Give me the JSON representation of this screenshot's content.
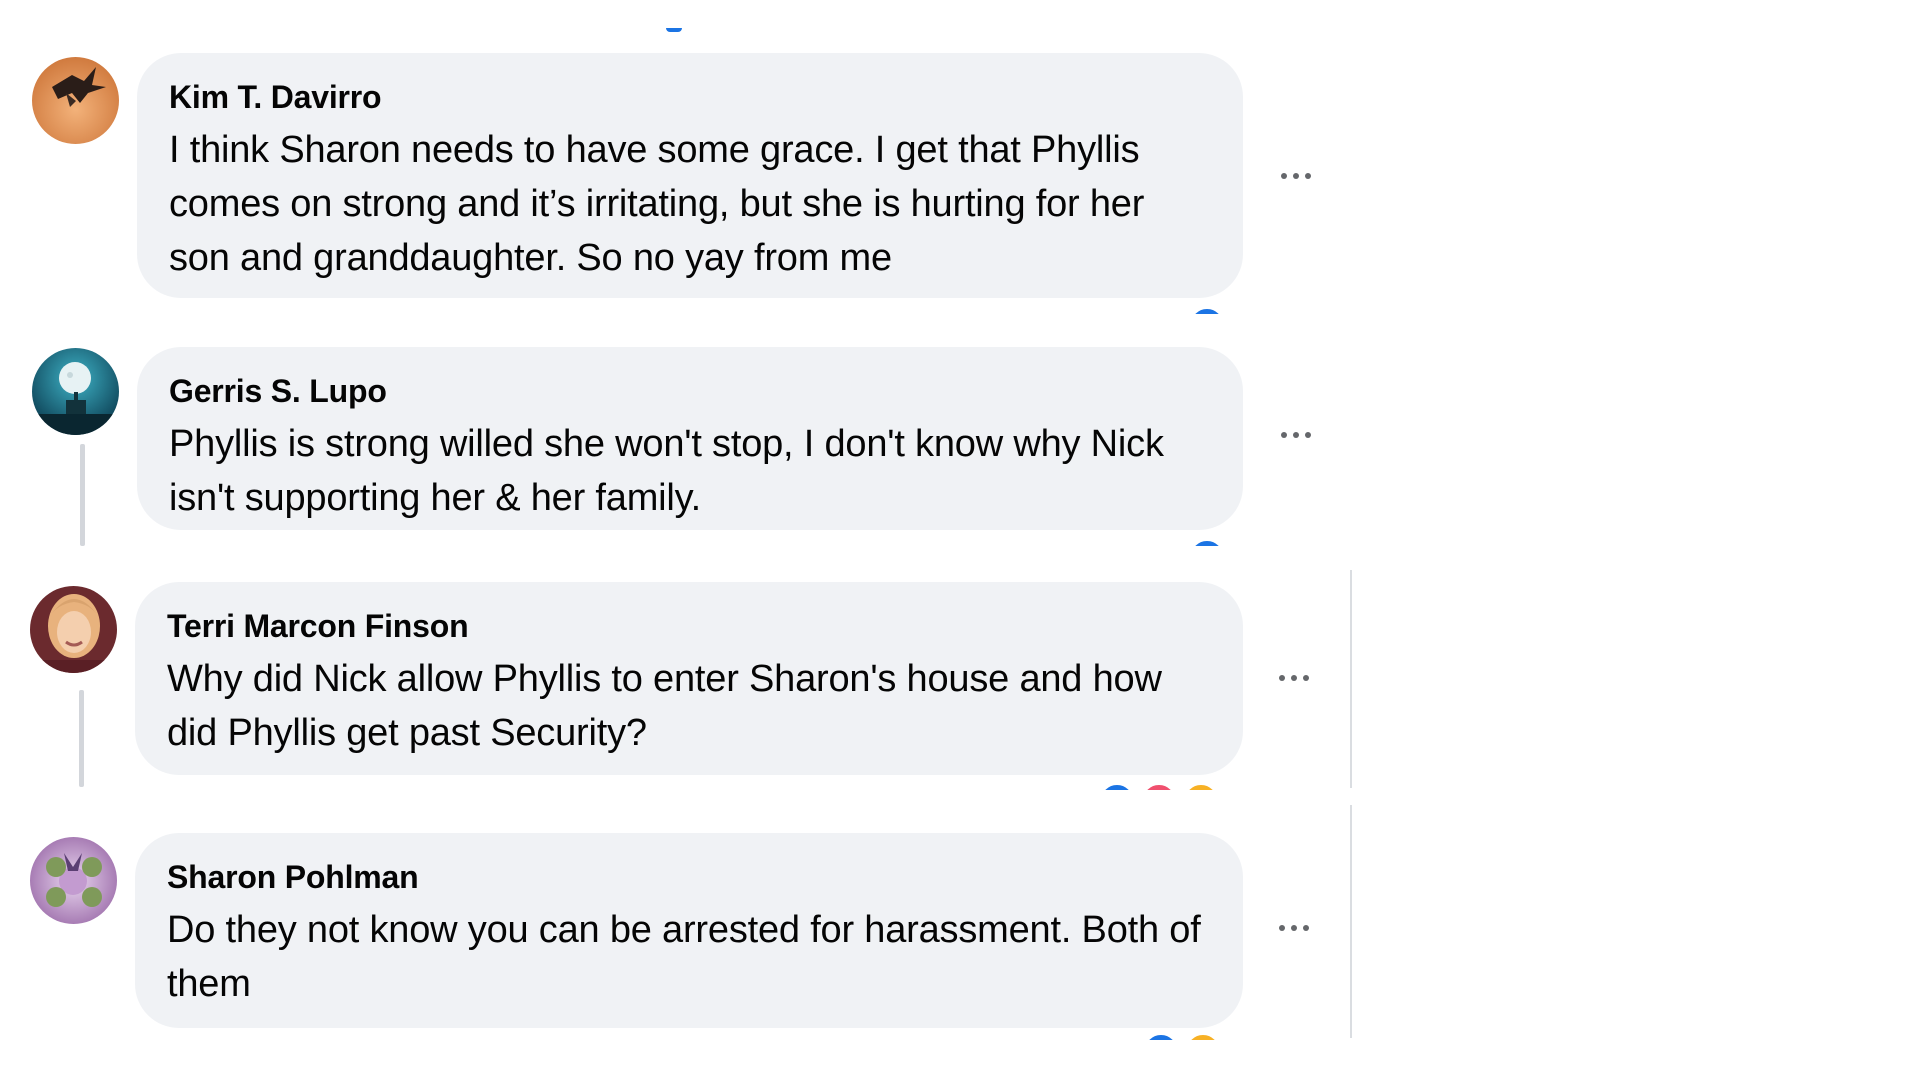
{
  "colors": {
    "bubble": "#f0f2f5",
    "text": "#050505",
    "more_icon": "#65676b",
    "like_blue": "#1b74e4",
    "love_red": "#f0506e",
    "care_yellow": "#f7b125"
  },
  "comments": [
    {
      "author": "Kim T. Davirro",
      "text": "I think Sharon needs to have some grace. I get that Phyllis comes on strong and it’s irritating, but she is hurting for her son and granddaughter. So no yay from me",
      "more_icon": "more-options-icon",
      "reactions": [
        "like"
      ]
    },
    {
      "author": "Gerris S. Lupo",
      "text": "Phyllis is strong willed she won't stop, I don't know why Nick isn't supporting her & her family.",
      "more_icon": "more-options-icon",
      "reactions": [
        "like"
      ]
    },
    {
      "author": "Terri Marcon Finson",
      "text": "Why did Nick allow Phyllis to enter Sharon's house and how did Phyllis get past Security?",
      "more_icon": "more-options-icon",
      "reactions": [
        "like",
        "love",
        "care"
      ]
    },
    {
      "author": "Sharon Pohlman",
      "text": "Do they not know you can be arrested for harassment. Both of them",
      "more_icon": "more-options-icon",
      "reactions": [
        "like",
        "care"
      ]
    }
  ]
}
